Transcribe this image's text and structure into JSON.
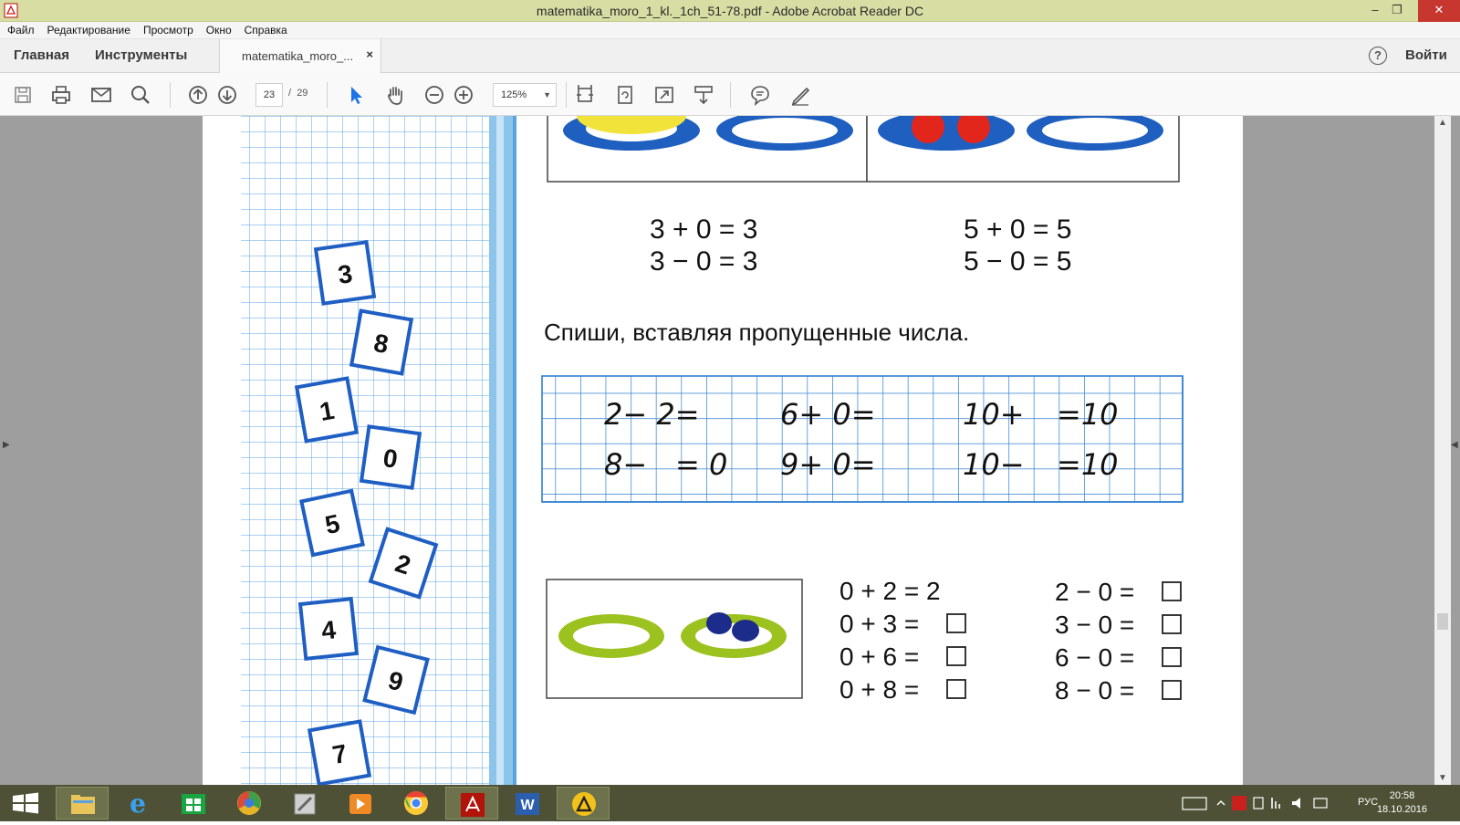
{
  "window": {
    "title": "matematika_moro_1_kl._1ch_51-78.pdf - Adobe Acrobat Reader DC",
    "minimize": "–",
    "maximize": "❐",
    "close": "✕"
  },
  "menu": [
    "Файл",
    "Редактирование",
    "Просмотр",
    "Окно",
    "Справка"
  ],
  "tabs": {
    "home": "Главная",
    "tools": "Инструменты",
    "document": "matematika_moro_...",
    "document_close": "×",
    "help": "?",
    "login": "Войти"
  },
  "toolbar": {
    "current_page": "23",
    "page_separator": "/",
    "total_pages": "29",
    "zoom": "125%",
    "icons": [
      "save-icon",
      "print-icon",
      "email-icon",
      "search-icon",
      "page-up-icon",
      "page-down-icon",
      "select-cursor-icon",
      "hand-icon",
      "zoom-out-icon",
      "zoom-in-icon",
      "fit-page-icon",
      "rotate-icon",
      "fullscreen-icon",
      "scroll-mode-icon",
      "comment-icon",
      "sign-icon"
    ]
  },
  "document": {
    "equations_top_left": [
      "3 + 0 = 3",
      "3 − 0 = 3"
    ],
    "equations_top_right": [
      "5 + 0 = 5",
      "5 − 0 = 5"
    ],
    "instruction": "Спиши,  вставляя  пропущенные  числа.",
    "grid_row1": [
      "2− 2=",
      "6+ 0=",
      "10+",
      "=10"
    ],
    "grid_row2": [
      "8−",
      "= 0",
      "9+ 0=",
      "10−",
      "=10"
    ],
    "bottom_left": [
      "0 + 2 = 2",
      "0 + 3 =",
      "0 + 6 =",
      "0 + 8 ="
    ],
    "bottom_right": [
      "2 − 0 =",
      "3 − 0 =",
      "6 − 0 =",
      "8 − 0 ="
    ],
    "cards": [
      "3",
      "8",
      "1",
      "0",
      "5",
      "2",
      "4",
      "9",
      "7"
    ]
  },
  "taskbar": {
    "apps": [
      "start-icon",
      "file-explorer-icon",
      "internet-explorer-icon",
      "store-icon",
      "chrome-like-icon",
      "tool-icon",
      "media-player-icon",
      "chrome-icon",
      "acrobat-icon",
      "word-icon",
      "archicad-icon"
    ],
    "language": "РУС",
    "time": "20:58",
    "date": "18.10.2016"
  },
  "colors": {
    "titlebar": "#d8dea3",
    "taskbar": "#4e5136",
    "grid_line": "#2e7fd0",
    "card_border": "#1f5fc4"
  }
}
